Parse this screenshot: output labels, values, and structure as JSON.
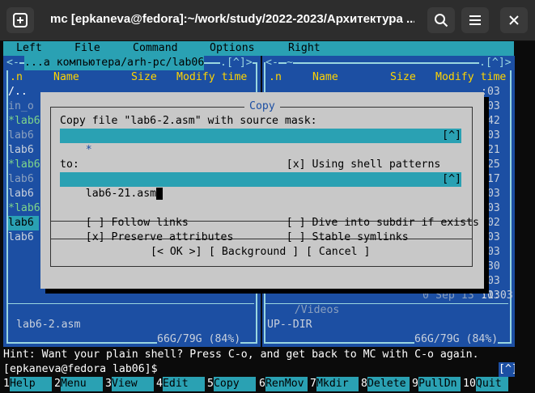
{
  "window": {
    "title": "mc [epkaneva@fedora]:~/work/study/2022-2023/Архитектура ...",
    "new_tab_icon": "plus-square-icon",
    "search_icon": "search-icon",
    "menu_icon": "hamburger-icon"
  },
  "menubar": [
    "Left",
    "File",
    "Command",
    "Options",
    "Right"
  ],
  "left_panel": {
    "path": "...а компьютера/arh-pc/lab06",
    "corner": ".[^]>",
    "prefix": "<-",
    "columns": {
      "n": ".n",
      "name": "Name",
      "size": "Size",
      "mtime": "Modify time"
    },
    "rows": [
      {
        "name": "/..",
        "style": "dir"
      },
      {
        "name": "in_o",
        "style": "dim"
      },
      {
        "name": "*lab6",
        "style": "exec"
      },
      {
        "name": "lab6",
        "style": "dim"
      },
      {
        "name": "lab6",
        "style": "normal"
      },
      {
        "name": "*lab6",
        "style": "exec"
      },
      {
        "name": "lab6",
        "style": "dim"
      },
      {
        "name": "lab6",
        "style": "normal"
      },
      {
        "name": "*lab6",
        "style": "exec"
      },
      {
        "name": "lab6",
        "style": "selected"
      },
      {
        "name": "lab6",
        "style": "normal"
      }
    ],
    "status": "lab6-2.asm",
    "disk": "66G/79G (84%)"
  },
  "right_panel": {
    "prefix": "<-",
    "path": "~",
    "corner": ".[^]>",
    "columns": {
      "n": ".n",
      "name": "Name",
      "size": "Size",
      "mtime": "Modify time"
    },
    "time_col": [
      ":03",
      ":03",
      ":42",
      ":03",
      ":21",
      ":25",
      ":17",
      ":03",
      ":03",
      ":02",
      ":03",
      ":03",
      ":30",
      ":03",
      ":03"
    ],
    "visible_row": {
      "name": "/Videos",
      "size": "0",
      "date": "Sep 13",
      "time": "11:03"
    },
    "status": "UP--DIR",
    "disk": "66G/79G (84%)"
  },
  "dialog": {
    "title": "Copy",
    "source_label": "Copy file \"lab6-2.asm\" with source mask:",
    "source_value": "*",
    "history_btn": "[^]",
    "shell_patterns": {
      "mark": "[x]",
      "label": "Using shell patterns"
    },
    "to_label": "to:",
    "to_value": "lab6-21.asm",
    "follow_links": {
      "mark": "[ ]",
      "label": "Follow links"
    },
    "preserve_attrs": {
      "mark": "[x]",
      "label": "Preserve attributes"
    },
    "dive_subdir": {
      "mark": "[ ]",
      "label": "Dive into subdir if exists"
    },
    "stable_symlinks": {
      "mark": "[ ]",
      "label": "Stable symlinks"
    },
    "ok_btn": "[< OK >]",
    "background_btn": "[ Background ]",
    "cancel_btn": "[ Cancel ]"
  },
  "hint": "Hint: Want your plain shell? Press C-o, and get back to MC with C-o again.",
  "prompt": "[epkaneva@fedora lab06]$",
  "prompt_history": "[^]",
  "fkeys": [
    {
      "num": "1",
      "label": "Help"
    },
    {
      "num": "2",
      "label": "Menu"
    },
    {
      "num": "3",
      "label": "View"
    },
    {
      "num": "4",
      "label": "Edit"
    },
    {
      "num": "5",
      "label": "Copy"
    },
    {
      "num": "6",
      "label": "RenMov"
    },
    {
      "num": "7",
      "label": "Mkdir"
    },
    {
      "num": "8",
      "label": "Delete"
    },
    {
      "num": "9",
      "label": "PullDn"
    },
    {
      "num": "10",
      "label": "Quit"
    }
  ]
}
